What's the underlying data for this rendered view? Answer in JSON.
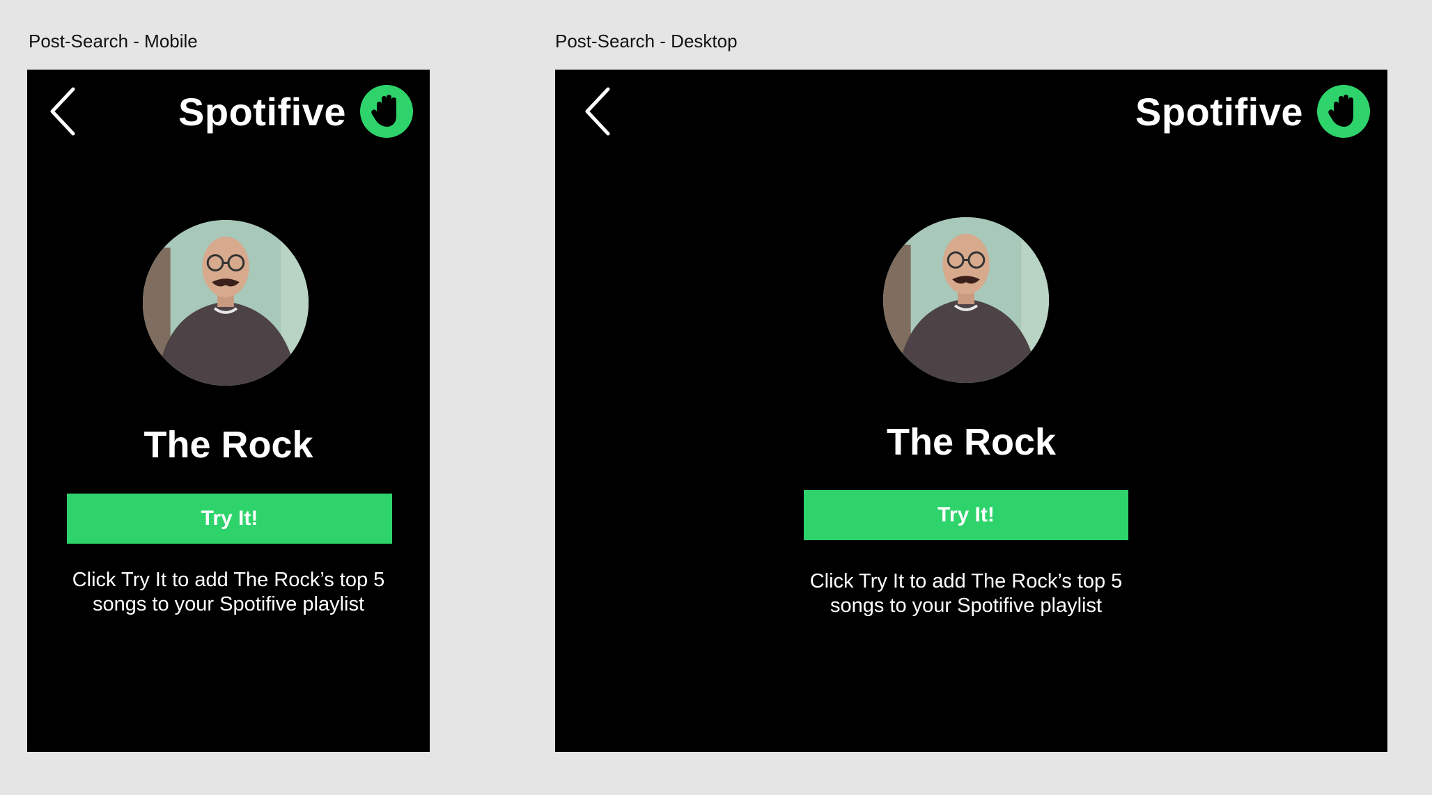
{
  "mobile": {
    "frame_label": "Post-Search - Mobile",
    "brand": "Spotifive",
    "artist_name": "The Rock",
    "button_label": "Try It!",
    "description": "Click Try It to add The Rock’s top 5 songs to your Spotifive playlist",
    "icons": {
      "back": "chevron-left-icon",
      "logo": "hand-icon"
    }
  },
  "desktop": {
    "frame_label": "Post-Search - Desktop",
    "brand": "Spotifive",
    "artist_name": "The Rock",
    "button_label": "Try It!",
    "description": "Click Try It to add The Rock’s top 5 songs to your Spotifive playlist",
    "icons": {
      "back": "chevron-left-icon",
      "logo": "hand-icon"
    }
  },
  "colors": {
    "canvas": "#e5e5e5",
    "frame_background": "#000000",
    "accent": "#2ed46b",
    "text": "#ffffff"
  }
}
